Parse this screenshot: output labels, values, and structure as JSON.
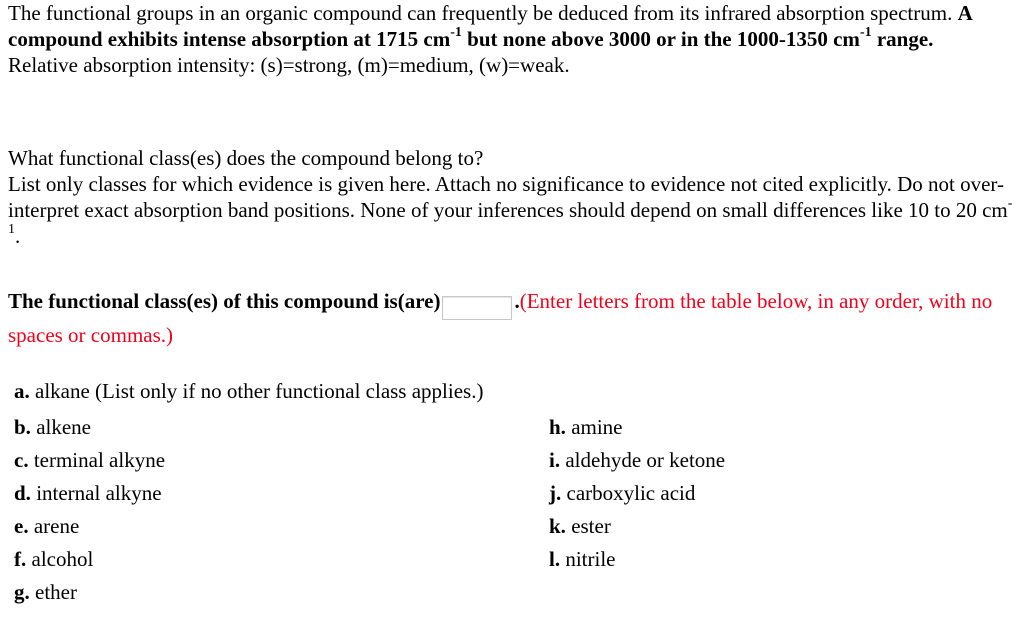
{
  "intro": {
    "line1": "The functional groups in an organic compound can frequently be deduced from its infrared absorption spectrum.",
    "bold_pre": "A compound exhibits intense absorption at 1715 cm",
    "bold_sup1": "-1",
    "bold_mid": " but none above 3000 or in the 1000-1350 cm",
    "bold_sup2": "-1",
    "bold_post": " range.",
    "intensity_legend": "Relative absorption intensity: (s)=strong, (m)=medium, (w)=weak."
  },
  "question": {
    "prompt": "What functional class(es) does the compound belong to?",
    "instructions": "List only classes for which evidence is given here. Attach no significance to evidence not cited explicitly. Do not over-interpret exact absorption band positions. None of your inferences should depend on small differences like 10 to 20 cm",
    "instructions_sup": "-1",
    "instructions_end": "."
  },
  "answer": {
    "label": "The functional class(es) of this compound is(are)",
    "input_value": "",
    "after_input": ".",
    "hint": "(Enter letters from the table below, in any order, with no spaces or commas.)",
    "hint_color": "#f4001a"
  },
  "options": [
    {
      "letter": "a.",
      "label": "alkane (List only if no other functional class applies.)"
    },
    {
      "letter": "b.",
      "label": "alkene"
    },
    {
      "letter": "c.",
      "label": "terminal alkyne"
    },
    {
      "letter": "d.",
      "label": "internal alkyne"
    },
    {
      "letter": "e.",
      "label": "arene"
    },
    {
      "letter": "f.",
      "label": "alcohol"
    },
    {
      "letter": "g.",
      "label": "ether"
    },
    {
      "letter": "h.",
      "label": "amine"
    },
    {
      "letter": "i.",
      "label": "aldehyde or ketone"
    },
    {
      "letter": "j.",
      "label": "carboxylic acid"
    },
    {
      "letter": "k.",
      "label": "ester"
    },
    {
      "letter": "l.",
      "label": "nitrile"
    }
  ]
}
